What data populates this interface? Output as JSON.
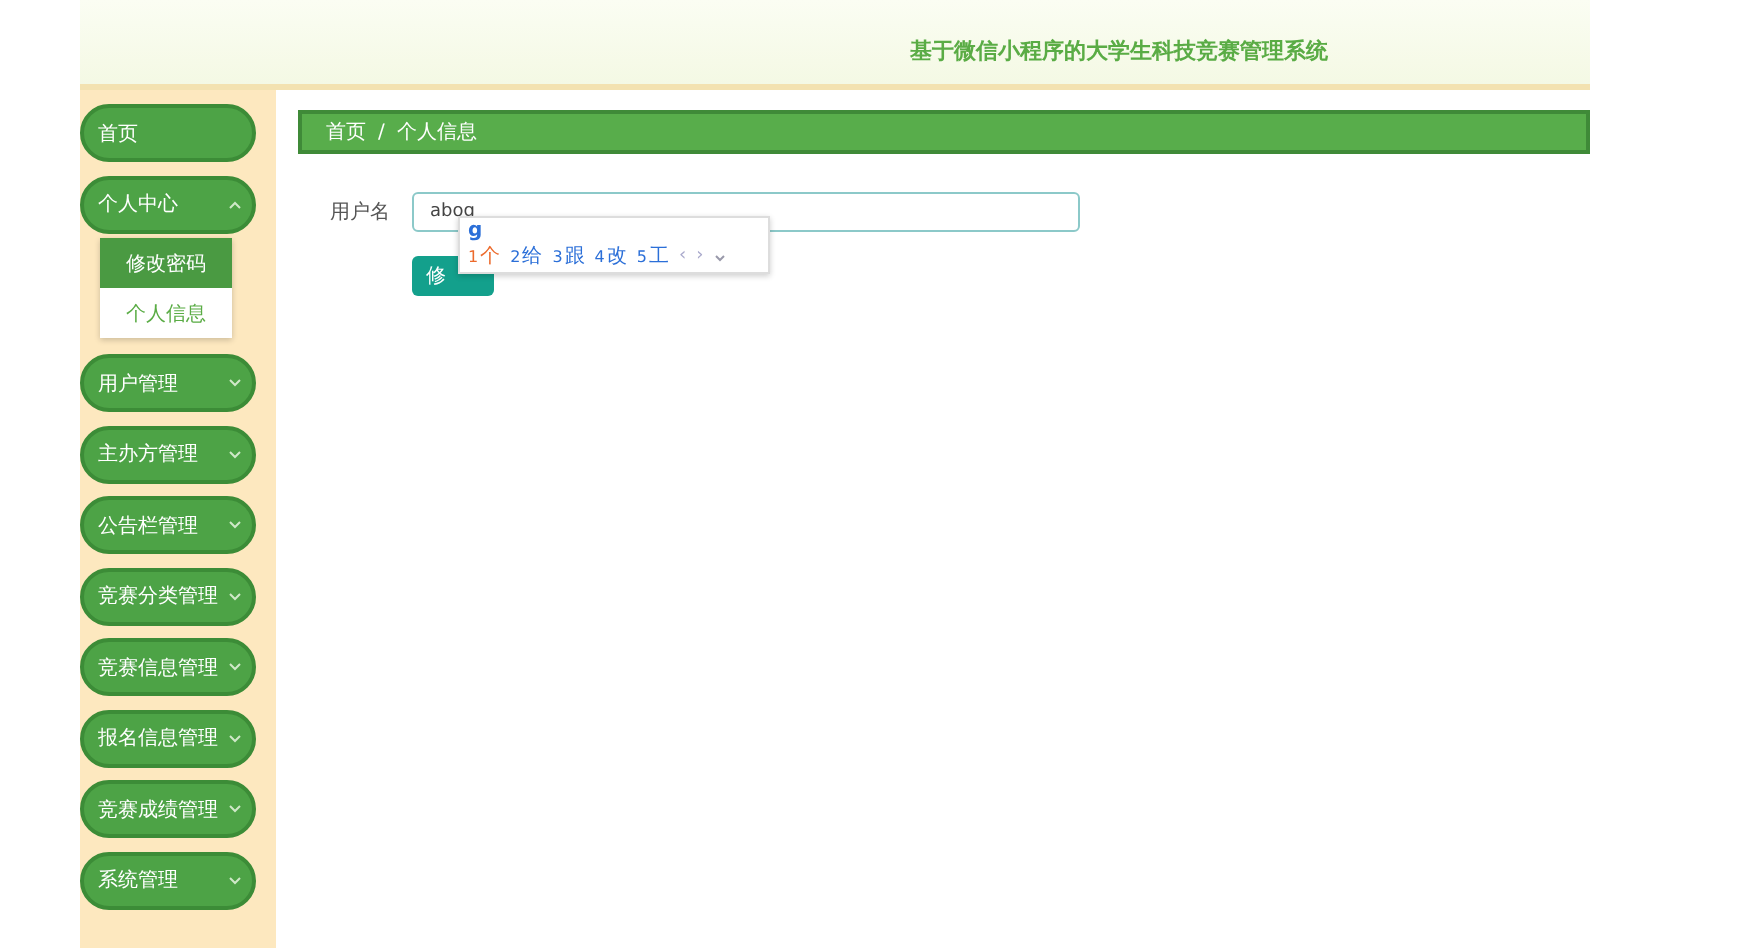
{
  "header": {
    "title": "基于微信小程序的大学生科技竞赛管理系统"
  },
  "sidebar": {
    "items": [
      {
        "label": "首页",
        "kind": "link"
      },
      {
        "label": "个人中心",
        "kind": "group",
        "expanded": true,
        "children": [
          {
            "label": "修改密码",
            "selected": true
          },
          {
            "label": "个人信息",
            "selected": false
          }
        ]
      },
      {
        "label": "用户管理",
        "kind": "group",
        "expanded": false
      },
      {
        "label": "主办方管理",
        "kind": "group",
        "expanded": false
      },
      {
        "label": "公告栏管理",
        "kind": "group",
        "expanded": false
      },
      {
        "label": "竞赛分类管理",
        "kind": "group",
        "expanded": false
      },
      {
        "label": "竞赛信息管理",
        "kind": "group",
        "expanded": false
      },
      {
        "label": "报名信息管理",
        "kind": "group",
        "expanded": false
      },
      {
        "label": "竞赛成绩管理",
        "kind": "group",
        "expanded": false
      },
      {
        "label": "系统管理",
        "kind": "group",
        "expanded": false
      }
    ]
  },
  "breadcrumb": [
    "首页",
    "个人信息"
  ],
  "breadcrumb_separator": "/",
  "form": {
    "label": "用户名",
    "value": "abog",
    "button": "修"
  },
  "ime": {
    "composition": "g",
    "candidates": [
      {
        "index": "1",
        "text": "个",
        "selected": true
      },
      {
        "index": "2",
        "text": "给",
        "selected": false
      },
      {
        "index": "3",
        "text": "跟",
        "selected": false
      },
      {
        "index": "4",
        "text": "改",
        "selected": false
      },
      {
        "index": "5",
        "text": "工",
        "selected": false
      }
    ],
    "prev": "‹",
    "next": "›"
  }
}
